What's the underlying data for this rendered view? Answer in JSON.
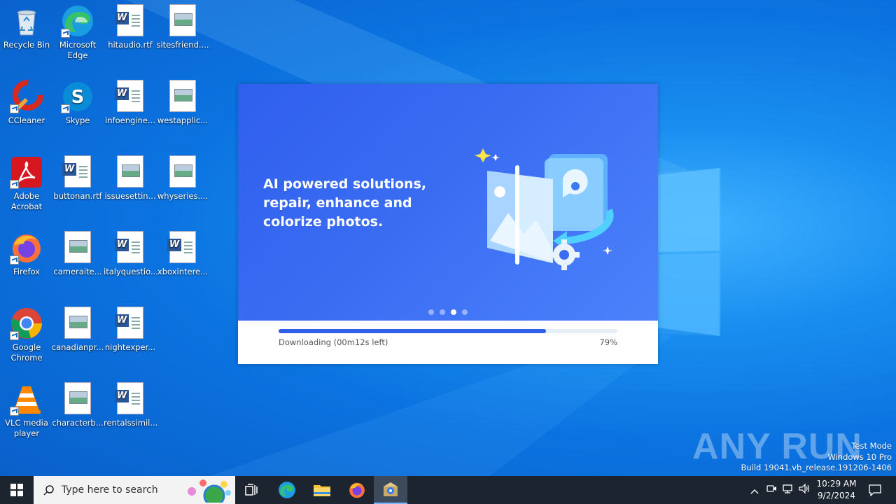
{
  "desktop": {
    "icons": [
      {
        "label": "Recycle Bin"
      },
      {
        "label": "Microsoft Edge"
      },
      {
        "label": "hitaudio.rtf"
      },
      {
        "label": "sitesfriend...."
      },
      {
        "label": "CCleaner"
      },
      {
        "label": "Skype"
      },
      {
        "label": "infoengine..."
      },
      {
        "label": "westapplic..."
      },
      {
        "label": "Adobe Acrobat"
      },
      {
        "label": "buttonan.rtf"
      },
      {
        "label": "issuesettin..."
      },
      {
        "label": "whyseries...."
      },
      {
        "label": "Firefox"
      },
      {
        "label": "cameraite..."
      },
      {
        "label": "italyquestio..."
      },
      {
        "label": "xboxintere..."
      },
      {
        "label": "Google Chrome"
      },
      {
        "label": "canadianpr..."
      },
      {
        "label": "nightexper..."
      },
      {
        "label": "VLC media player"
      },
      {
        "label": "characterb..."
      },
      {
        "label": "rentalssimil..."
      }
    ]
  },
  "installer": {
    "headline": "AI powered solutions, repair, enhance and colorize photos.",
    "carousel_active_index": 2,
    "carousel_count": 4,
    "progress_percent": 79,
    "status": "Downloading (00m12s left)",
    "percent_label": "79%"
  },
  "watermark": {
    "logo_text": "ANY RUN",
    "test_mode": "Test Mode",
    "edition": "Windows 10 Pro",
    "build": "Build 19041.vb_release.191206-1406"
  },
  "taskbar": {
    "search_placeholder": "Type here to search",
    "time": "10:29 AM",
    "date": "9/2/2024"
  },
  "colors": {
    "banner": "#3a6cf2",
    "progress": "#2e5fe6",
    "taskbar": "#1c2430"
  }
}
